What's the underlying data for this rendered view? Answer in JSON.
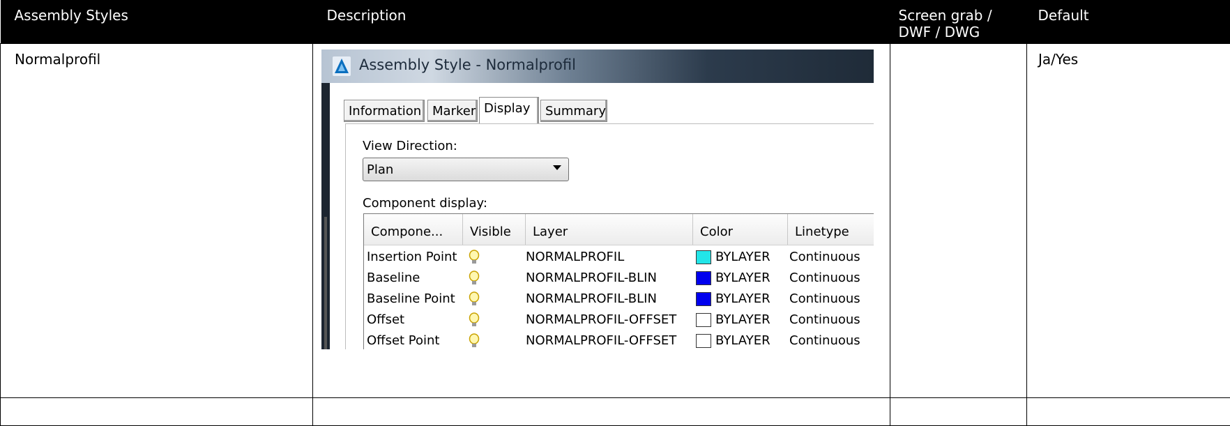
{
  "table": {
    "headers": [
      "Assembly Styles",
      "Description",
      "Screen grab / DWF / DWG",
      "Default"
    ],
    "rows": [
      {
        "style": "Normalprofil",
        "default": "Ja/Yes"
      }
    ]
  },
  "dialog": {
    "title": "Assembly Style - Normalprofil",
    "tabs": [
      "Information",
      "Marker",
      "Display",
      "Summary"
    ],
    "active_tab": "Display",
    "view_direction_label": "View Direction:",
    "view_direction_value": "Plan",
    "component_display_label": "Component display:",
    "columns": [
      "Compone...",
      "Visible",
      "Layer",
      "Color",
      "Linetype"
    ],
    "components": [
      {
        "name": "Insertion Point",
        "visible_icon": "lightbulb-on-icon",
        "layer": "NORMALPROFIL",
        "color": "BYLAYER",
        "swatch": "#22e5e8",
        "linetype": "Continuous"
      },
      {
        "name": "Baseline",
        "visible_icon": "lightbulb-on-icon",
        "layer": "NORMALPROFIL-BLIN",
        "color": "BYLAYER",
        "swatch": "#0000ee",
        "linetype": "Continuous"
      },
      {
        "name": "Baseline Point",
        "visible_icon": "lightbulb-on-icon",
        "layer": "NORMALPROFIL-BLIN",
        "color": "BYLAYER",
        "swatch": "#0000ee",
        "linetype": "Continuous"
      },
      {
        "name": "Offset",
        "visible_icon": "lightbulb-on-icon",
        "layer": "NORMALPROFIL-OFFSET",
        "color": "BYLAYER",
        "swatch": "#ffffff",
        "linetype": "Continuous"
      },
      {
        "name": "Offset Point",
        "visible_icon": "lightbulb-on-icon",
        "layer": "NORMALPROFIL-OFFSET",
        "color": "BYLAYER",
        "swatch": "#ffffff",
        "linetype": "Continuous"
      }
    ]
  }
}
